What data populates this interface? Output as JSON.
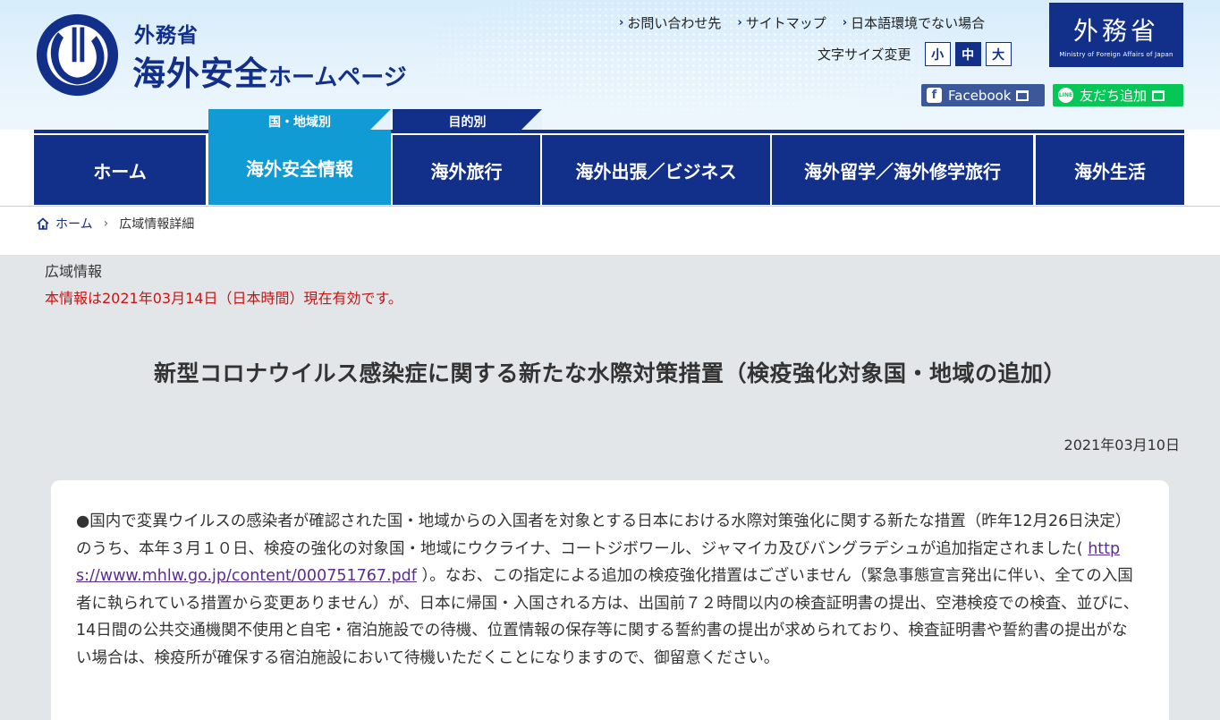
{
  "header": {
    "org": "外務省",
    "site_name": "海外安全",
    "site_name_suffix": "ホームページ",
    "top_links": [
      "お問い合わせ先",
      "サイトマップ",
      "日本語環境でない場合"
    ],
    "font_size_label": "文字サイズ変更",
    "font_sizes": [
      "小",
      "中",
      "大"
    ],
    "font_size_selected": "中",
    "mofa_logo_jp": "外務省",
    "mofa_logo_en": "Ministry of Foreign Affairs of Japan",
    "facebook_label": "Facebook",
    "line_label": "友だち追加"
  },
  "category_tabs": [
    "国・地域別",
    "目的別"
  ],
  "nav": {
    "items": [
      "ホーム",
      "海外安全情報",
      "海外旅行",
      "海外出張／ビジネス",
      "海外留学／海外修学旅行",
      "海外生活"
    ],
    "active": "海外安全情報"
  },
  "breadcrumb": {
    "home": "ホーム",
    "current": "広域情報詳細"
  },
  "article": {
    "kind": "広域情報",
    "validity": "本情報は2021年03月14日（日本時間）現在有効です。",
    "title": "新型コロナウイルス感染症に関する新たな水際対策措置（検疫強化対象国・地域の追加）",
    "date": "2021年03月10日",
    "body_before_link": "●国内で変異ウイルスの感染者が確認された国・地域からの入国者を対象とする日本における水際対策強化に関する新たな措置（昨年12月26日決定）のうち、本年３月１０日、検疫の強化の対象国・地域にウクライナ、コートジボワール、ジャマイカ及びバングラデシュが追加指定されました(",
    "link": "https://www.mhlw.go.jp/content/000751767.pdf",
    "body_after_link": "）。なお、この指定による追加の検疫強化措置はございません（緊急事態宣言発出に伴い、全ての入国者に執られている措置から変更ありません）が、日本に帰国・入国される方は、出国前７２時間以内の検査証明書の提出、空港検疫での検査、並びに、14日間の公共交通機関不使用と自宅・宿泊施設での待機、位置情報の保存等に関する誓約書の提出が求められており、検査証明書や誓約書の提出がない場合は、検疫所が確保する宿泊施設において待機いただくことになりますので、御留意ください。"
  },
  "colors": {
    "navy": "#12308a",
    "cyan": "#119bd4",
    "alert_red": "#c81414",
    "facebook": "#3b5998",
    "line": "#06c755"
  }
}
